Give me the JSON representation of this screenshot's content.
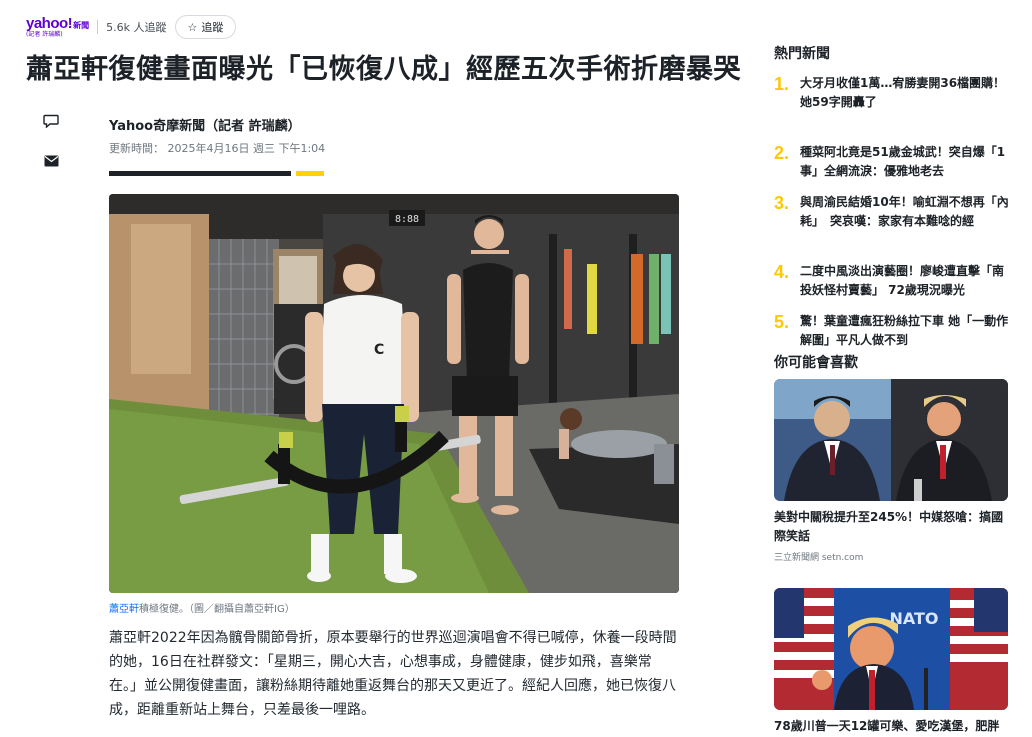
{
  "publisher": {
    "logo_text": "yahoo!",
    "logo_suffix": "新聞",
    "logo_subtitle": "(記者 許瑞麟)",
    "followers": "5.6k 人追蹤",
    "follow_label": "追蹤"
  },
  "article": {
    "headline": "蕭亞軒復健畫面曝光「已恢復八成」經歷五次手術折磨暴哭",
    "author": "Yahoo奇摩新聞（記者 許瑞麟）",
    "updated": "更新時間： 2025年4月16日 週三 下午1:04",
    "caption_link": "蕭亞軒",
    "caption_text": "積極復健。（圖／翻攝自蕭亞軒IG）",
    "hero_clock": "8:88",
    "body": "蕭亞軒2022年因為髖骨關節骨折，原本要舉行的世界巡迴演唱會不得已喊停，休養一段時間的她，16日在社群發文：「星期三，開心大吉，心想事成，身體健康，健步如飛，喜樂常在。」並公開復健畫面，讓粉絲期待離她重返舞台的那天又更近了。經紀人回應，她已恢復八成，距離重新站上舞台，只差最後一哩路。"
  },
  "share": {
    "comment_icon": "comment-icon",
    "mail_icon": "mail-icon"
  },
  "rail": {
    "trending_title": "熱門新聞",
    "trending": [
      {
        "num": "1.",
        "text": "大牙月收僅1萬…宥勝妻開36檔團購！她59字開轟了"
      },
      {
        "num": "2.",
        "text": "種菜阿北竟是51歲金城武！突自爆「1事」全網流淚：優雅地老去"
      },
      {
        "num": "3.",
        "text": "與周渝民結婚10年！喻虹淵不想再「內耗」　突哀嘆：家家有本難唸的經"
      },
      {
        "num": "4.",
        "text": "二度中風淡出演藝圈！廖峻遭直擊「南投妖怪村賣藝」 72歲現況曝光"
      },
      {
        "num": "5.",
        "text": "驚！葉童遭瘋狂粉絲拉下車 她「一動作解圍」平凡人做不到"
      }
    ],
    "recommend_title": "你可能會喜歡",
    "cards": [
      {
        "title": "美對中關稅提升至245%！中媒怒嗆：搞國際笑話",
        "source": "三立新聞網 setn.com"
      },
      {
        "title": "78歲川普一天12罐可樂、愛吃漢堡，肥胖",
        "source": "",
        "sign_text": "NATO"
      }
    ]
  }
}
